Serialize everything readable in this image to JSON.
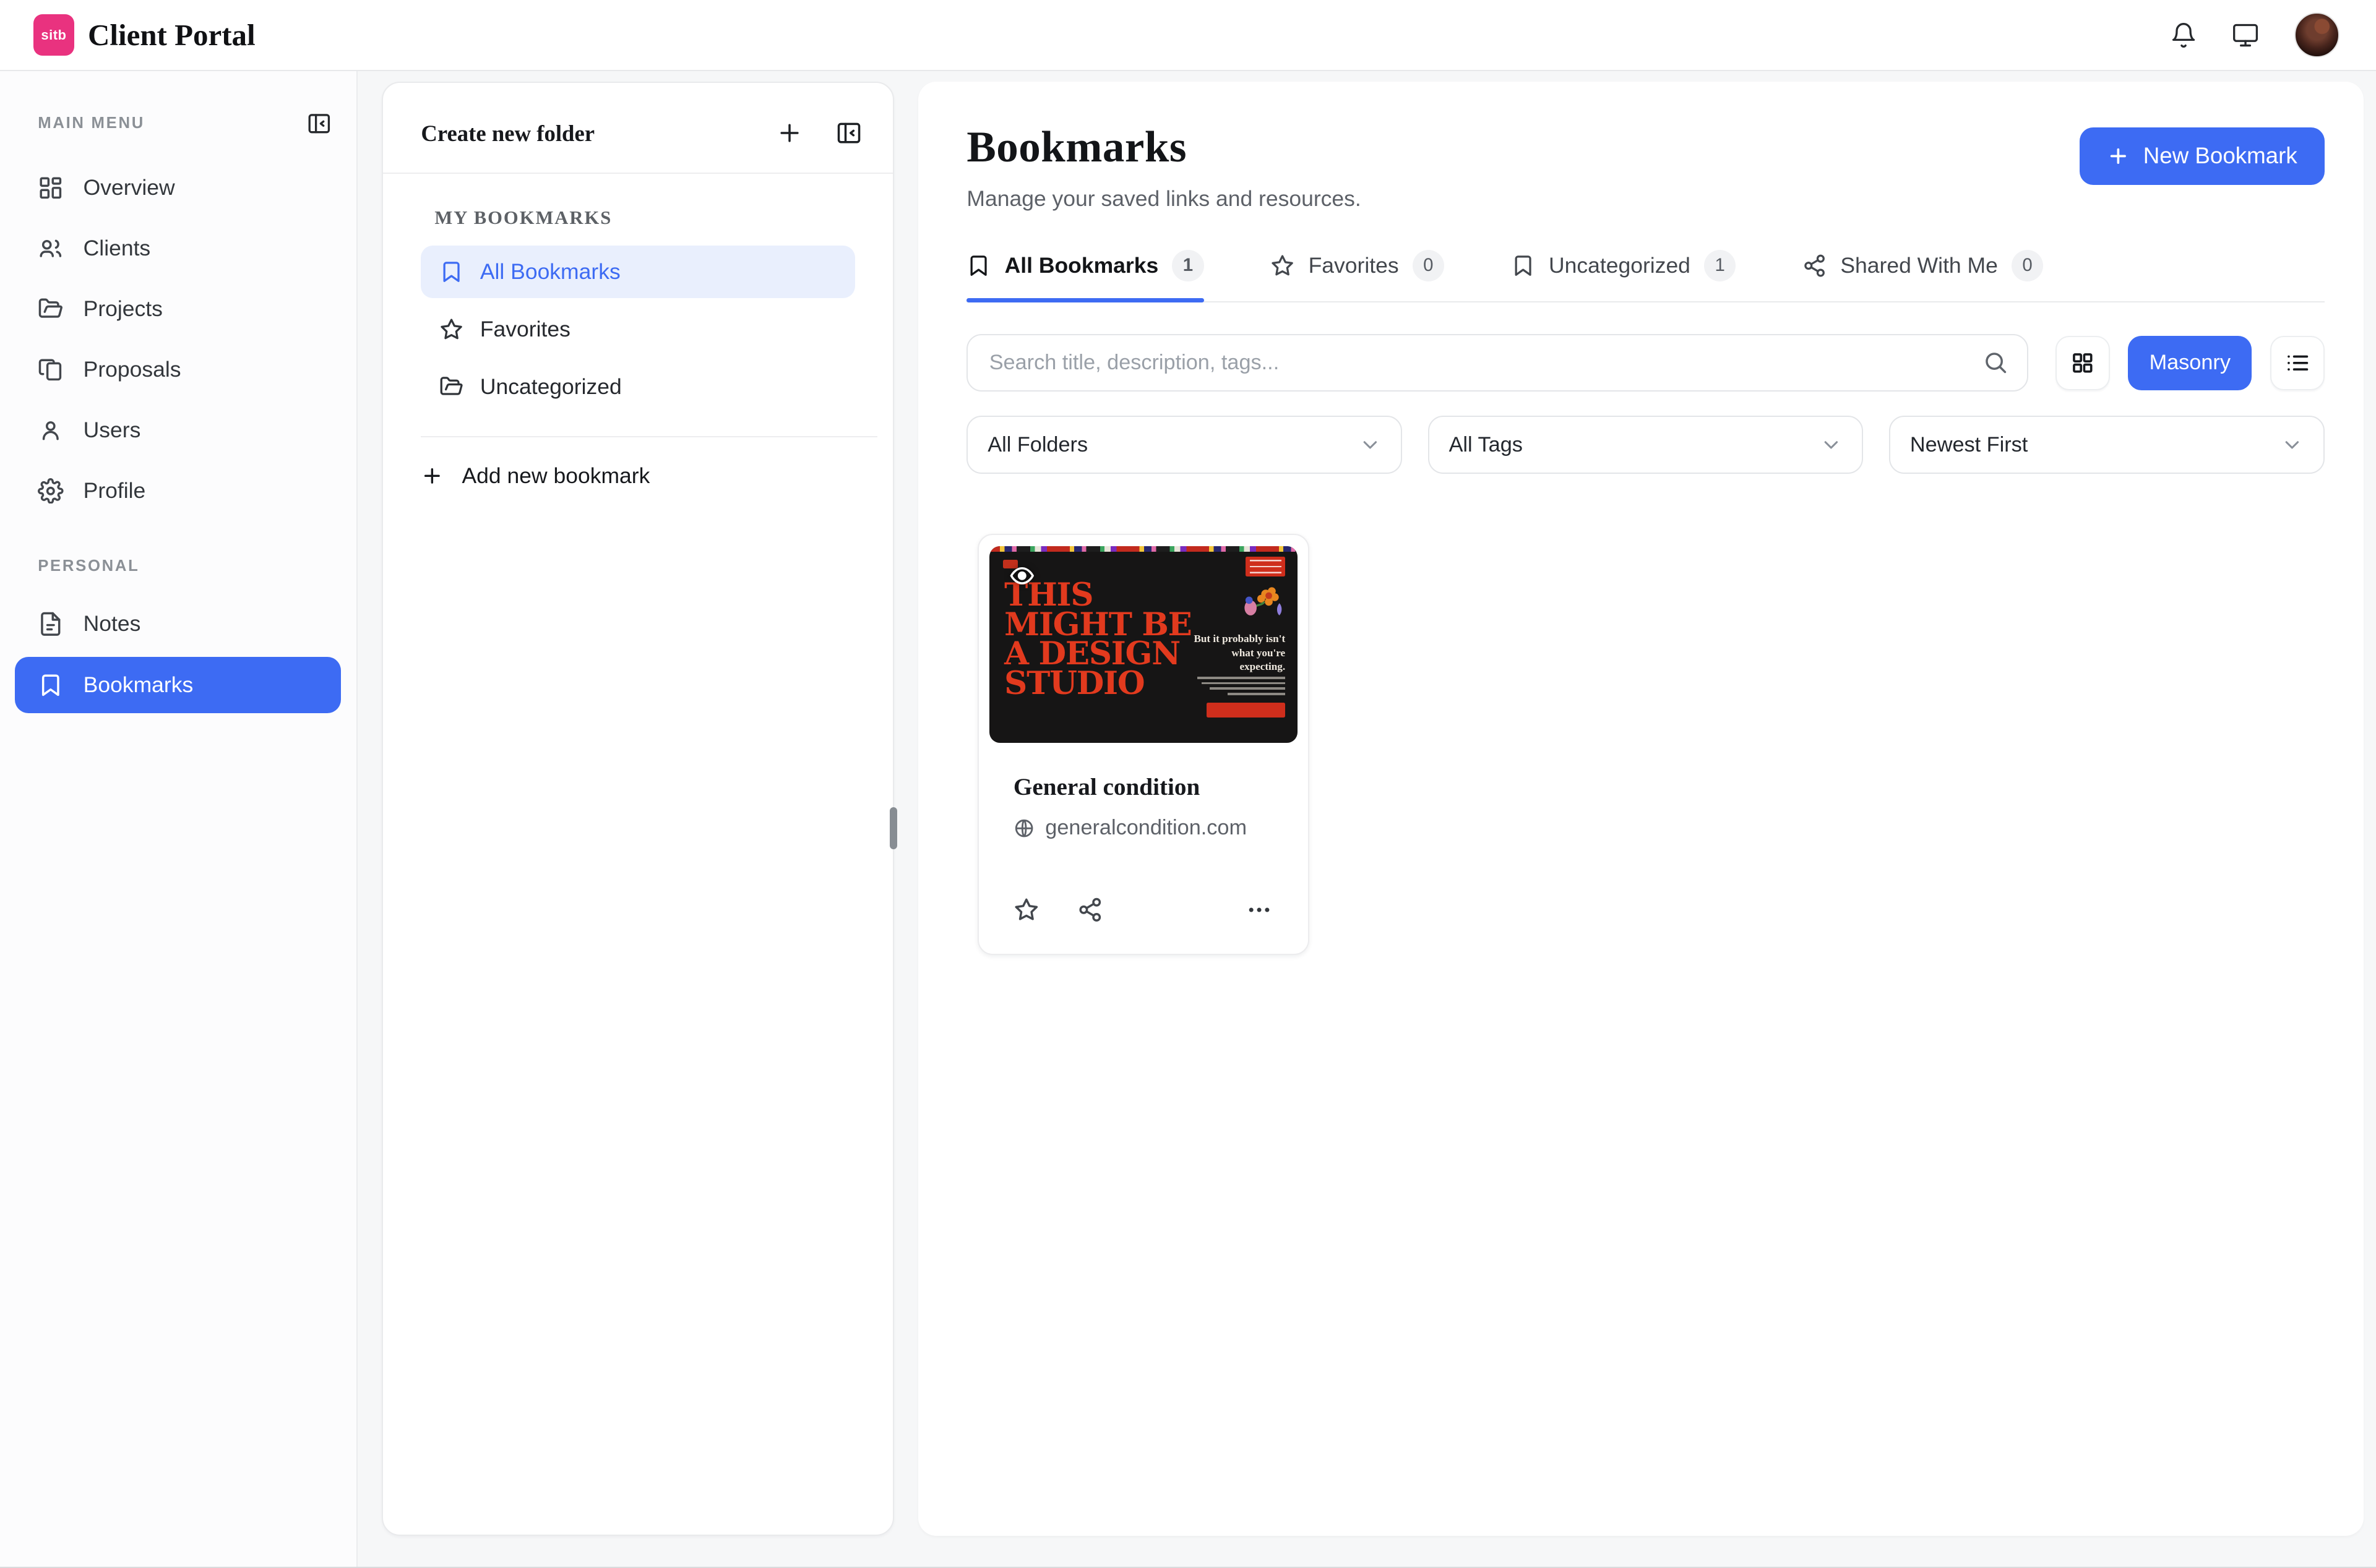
{
  "topbar": {
    "logo_text": "sitb",
    "app_title": "Client Portal"
  },
  "sidebar": {
    "section_main": "MAIN MENU",
    "items": [
      {
        "label": "Overview",
        "icon": "dashboard-icon"
      },
      {
        "label": "Clients",
        "icon": "users-icon"
      },
      {
        "label": "Projects",
        "icon": "folder-open-icon"
      },
      {
        "label": "Proposals",
        "icon": "copy-icon"
      },
      {
        "label": "Users",
        "icon": "user-icon"
      },
      {
        "label": "Profile",
        "icon": "gear-icon"
      }
    ],
    "section_personal": "PERSONAL",
    "personal": [
      {
        "label": "Notes",
        "icon": "note-icon",
        "active": false
      },
      {
        "label": "Bookmarks",
        "icon": "bookmark-icon",
        "active": true
      }
    ]
  },
  "folder_panel": {
    "title": "Create new folder",
    "section": "MY BOOKMARKS",
    "folders": [
      {
        "label": "All Bookmarks",
        "icon": "bookmark-icon",
        "selected": true
      },
      {
        "label": "Favorites",
        "icon": "star-icon",
        "selected": false
      },
      {
        "label": "Uncategorized",
        "icon": "folder-open-icon",
        "selected": false
      }
    ],
    "add_new": "Add new bookmark"
  },
  "main": {
    "title": "Bookmarks",
    "subtitle": "Manage your saved links and resources.",
    "new_button": "New Bookmark",
    "tabs": [
      {
        "label": "All Bookmarks",
        "count": "1",
        "active": true
      },
      {
        "label": "Favorites",
        "count": "0",
        "active": false
      },
      {
        "label": "Uncategorized",
        "count": "1",
        "active": false
      },
      {
        "label": "Shared With Me",
        "count": "0",
        "active": false
      }
    ],
    "search_placeholder": "Search title, description, tags...",
    "view": {
      "masonry": "Masonry"
    },
    "filters": {
      "folders": "All Folders",
      "tags": "All Tags",
      "sort": "Newest First"
    },
    "cards": [
      {
        "title": "General condition",
        "url": "generalcondition.com",
        "preview": {
          "headline_lines": [
            "THIS",
            "MIGHT BE",
            "A DESIGN",
            "STUDIO"
          ],
          "tagline": "But it probably isn't what you're expecting."
        }
      }
    ]
  },
  "colors": {
    "accent": "#3d6bf3",
    "accent_soft": "#e9effd",
    "brand_pink": "#e9327f",
    "preview_bg": "#161515",
    "preview_red": "#e23a1e"
  }
}
